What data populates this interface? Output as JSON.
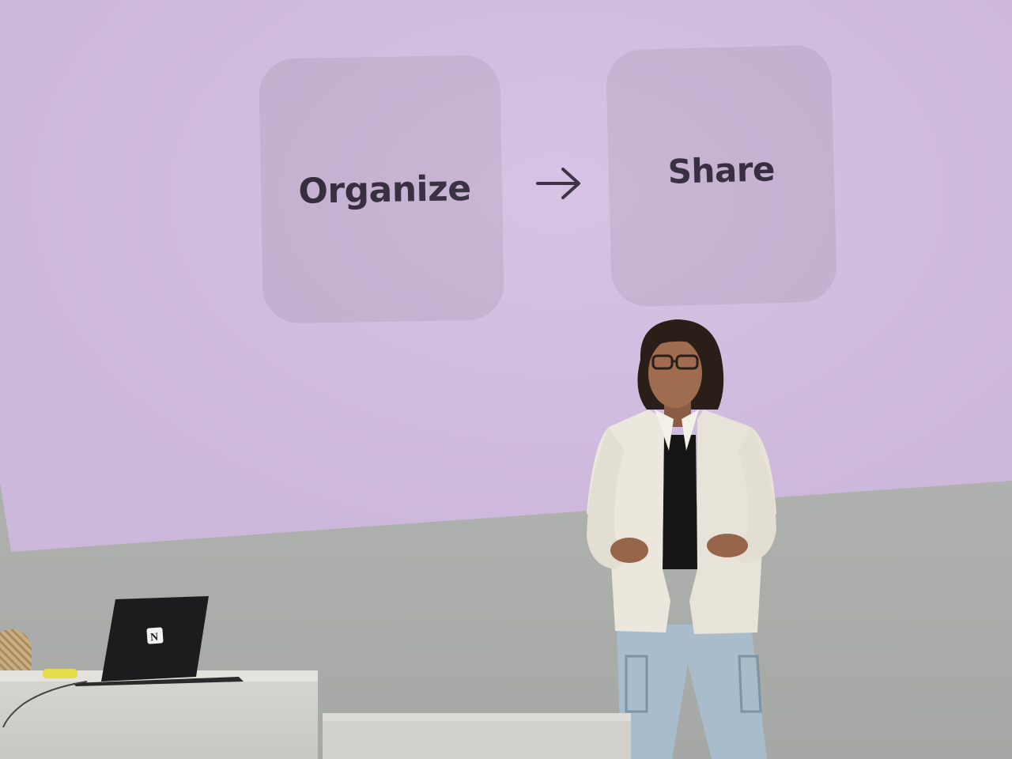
{
  "slide": {
    "background_color": "#d3bee2",
    "card_color": "#c5b1d2",
    "text_color": "#2e2438",
    "steps": [
      {
        "label": "Organize"
      },
      {
        "label": "Share"
      }
    ],
    "connector_icon": "arrow-right-icon"
  },
  "stage": {
    "presenter": "woman-presenting",
    "laptop_logo_icon": "notion-logo-icon"
  }
}
